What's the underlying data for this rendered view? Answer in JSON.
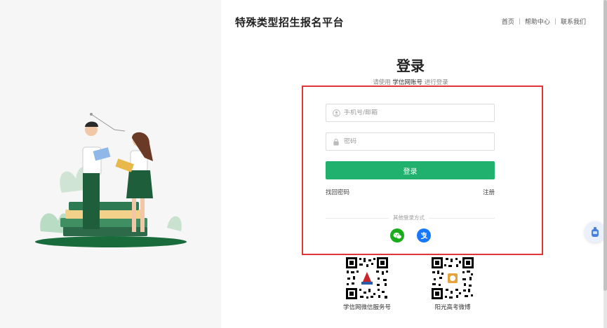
{
  "header": {
    "site_title": "特殊类型招生报名平台",
    "nav": [
      "首页",
      "帮助中心",
      "联系我们"
    ]
  },
  "login": {
    "title": "登录",
    "hint_prefix": "请使用",
    "hint_emphasis": "学信网账号",
    "hint_suffix": "进行登录",
    "username_placeholder": "手机号/邮箱",
    "password_placeholder": "密码",
    "submit_label": "登录",
    "forgot_label": "找回密码",
    "register_label": "注册",
    "other_methods_label": "其他登录方式"
  },
  "social_logins": [
    {
      "icon": "wechat-icon",
      "color": "#1aad19"
    },
    {
      "icon": "alipay-icon",
      "color": "#1677ff"
    }
  ],
  "qrcodes": [
    {
      "label": "学信网微信服务号"
    },
    {
      "label": "阳光高考微博"
    }
  ],
  "colors": {
    "accent": "#1fb16d",
    "highlight_border": "#e03636"
  }
}
